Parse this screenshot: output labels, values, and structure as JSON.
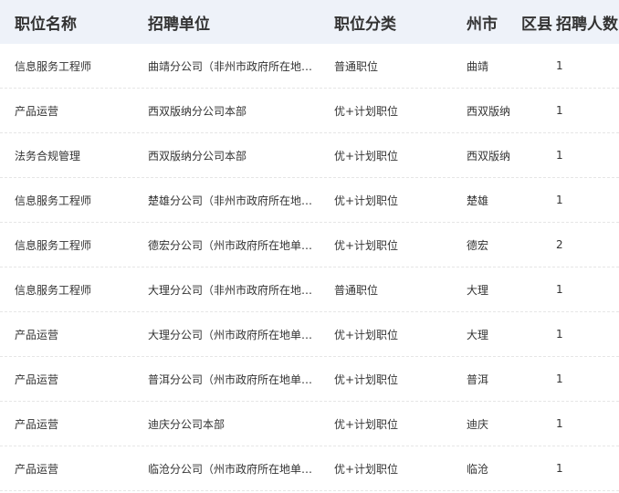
{
  "headers": {
    "position": "职位名称",
    "unit": "招聘单位",
    "category": "职位分类",
    "prefecture": "州市",
    "district": "区县",
    "count": "招聘人数"
  },
  "rows": [
    {
      "position": "信息服务工程师",
      "unit": "曲靖分公司（非州市政府所在地单位）",
      "category": "普通职位",
      "location": "曲靖",
      "count": "1"
    },
    {
      "position": "产品运营",
      "unit": "西双版纳分公司本部",
      "category": "优+计划职位",
      "location": "西双版纳",
      "count": "1"
    },
    {
      "position": "法务合规管理",
      "unit": "西双版纳分公司本部",
      "category": "优+计划职位",
      "location": "西双版纳",
      "count": "1"
    },
    {
      "position": "信息服务工程师",
      "unit": "楚雄分公司（非州市政府所在地单位）",
      "category": "优+计划职位",
      "location": "楚雄",
      "count": "1"
    },
    {
      "position": "信息服务工程师",
      "unit": "德宏分公司（州市政府所在地单位）",
      "category": "优+计划职位",
      "location": "德宏",
      "count": "2"
    },
    {
      "position": "信息服务工程师",
      "unit": "大理分公司（非州市政府所在地单位）",
      "category": "普通职位",
      "location": "大理",
      "count": "1"
    },
    {
      "position": "产品运营",
      "unit": "大理分公司（州市政府所在地单位）",
      "category": "优+计划职位",
      "location": "大理",
      "count": "1"
    },
    {
      "position": "产品运营",
      "unit": "普洱分公司（州市政府所在地单位）",
      "category": "优+计划职位",
      "location": "普洱",
      "count": "1"
    },
    {
      "position": "产品运营",
      "unit": "迪庆分公司本部",
      "category": "优+计划职位",
      "location": "迪庆",
      "count": "1"
    },
    {
      "position": "产品运营",
      "unit": "临沧分公司（州市政府所在地单位）",
      "category": "优+计划职位",
      "location": "临沧",
      "count": "1"
    }
  ]
}
